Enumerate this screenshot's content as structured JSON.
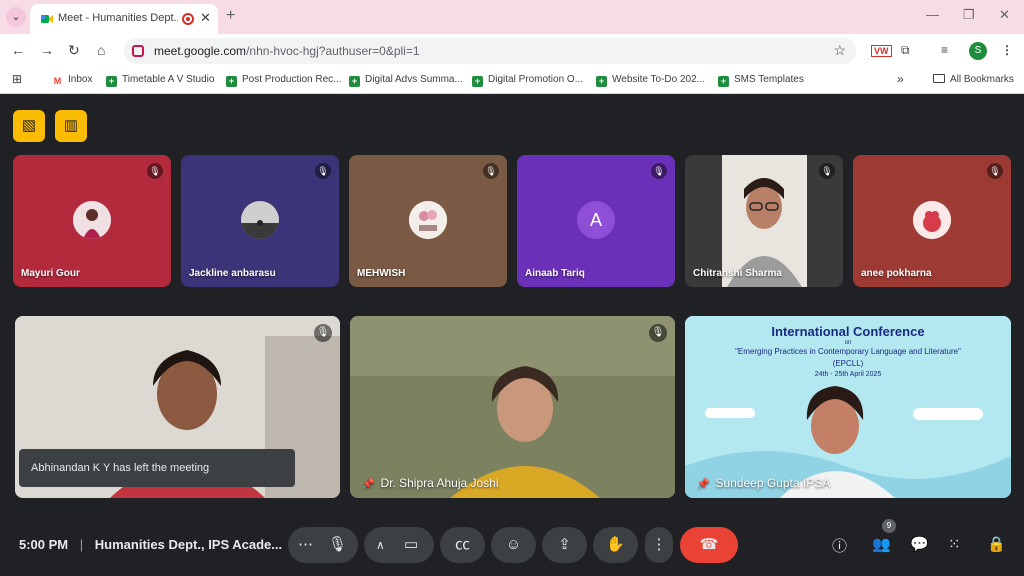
{
  "browser": {
    "tab_title": "Meet - Humanities Dept., IP",
    "url_host": "meet.google.com",
    "url_path": "/nhn-hvoc-hgj?authuser=0&pli=1",
    "profile_initial": "S",
    "bookmarks": [
      {
        "label": "Inbox",
        "icon": "gmail-icon"
      },
      {
        "label": "Timetable A V Studio",
        "icon": "sheets-icon"
      },
      {
        "label": "Post Production Rec...",
        "icon": "sheets-icon"
      },
      {
        "label": "Digital Advs Summa...",
        "icon": "sheets-icon"
      },
      {
        "label": "Digital Promotion O...",
        "icon": "sheets-icon"
      },
      {
        "label": "Website To-Do 202...",
        "icon": "sheets-icon"
      },
      {
        "label": "SMS Templates",
        "icon": "sheets-icon"
      }
    ],
    "all_bookmarks_label": "All Bookmarks"
  },
  "participants_small": [
    {
      "name": "Mayuri Gour",
      "avatar": "photo",
      "bg": "#b32a3c"
    },
    {
      "name": "Jackline anbarasu",
      "avatar": "photo",
      "bg": "#3c3478"
    },
    {
      "name": "MEHWISH",
      "avatar": "photo",
      "bg": "#7a5a44"
    },
    {
      "name": "Ainaab Tariq",
      "avatar": "letter",
      "letter": "A",
      "bg": "#6b30b8"
    },
    {
      "name": "Chitranshi Sharma",
      "avatar": "video",
      "bg": "#3a3a3a"
    },
    {
      "name": "anee pokharna",
      "avatar": "photo",
      "bg": "#9c3a33"
    }
  ],
  "participants_large": [
    {
      "name": "",
      "bg": "#cfcac4"
    },
    {
      "name": "Dr. Shipra Ahuja Joshi",
      "bg": "#6a6e52"
    },
    {
      "name": "Sundeep Gupta IPSA",
      "bg": "#a8e3ee"
    }
  ],
  "poster": {
    "title": "International Conference",
    "on": "on",
    "subtitle": "\"Emerging Practices in Contemporary Language and Literature\"",
    "abbr": "(EPCLL)",
    "dates": "24th - 25th April 2025"
  },
  "toast": "Abhinandan K Y has left the meeting",
  "footer": {
    "time": "5:00 PM",
    "meeting_name": "Humanities Dept., IPS Acade...",
    "people_count": "9"
  },
  "colors": {
    "accent_yellow": "#fbbc04",
    "end_call_red": "#ea4335",
    "stage_bg": "#202124"
  }
}
